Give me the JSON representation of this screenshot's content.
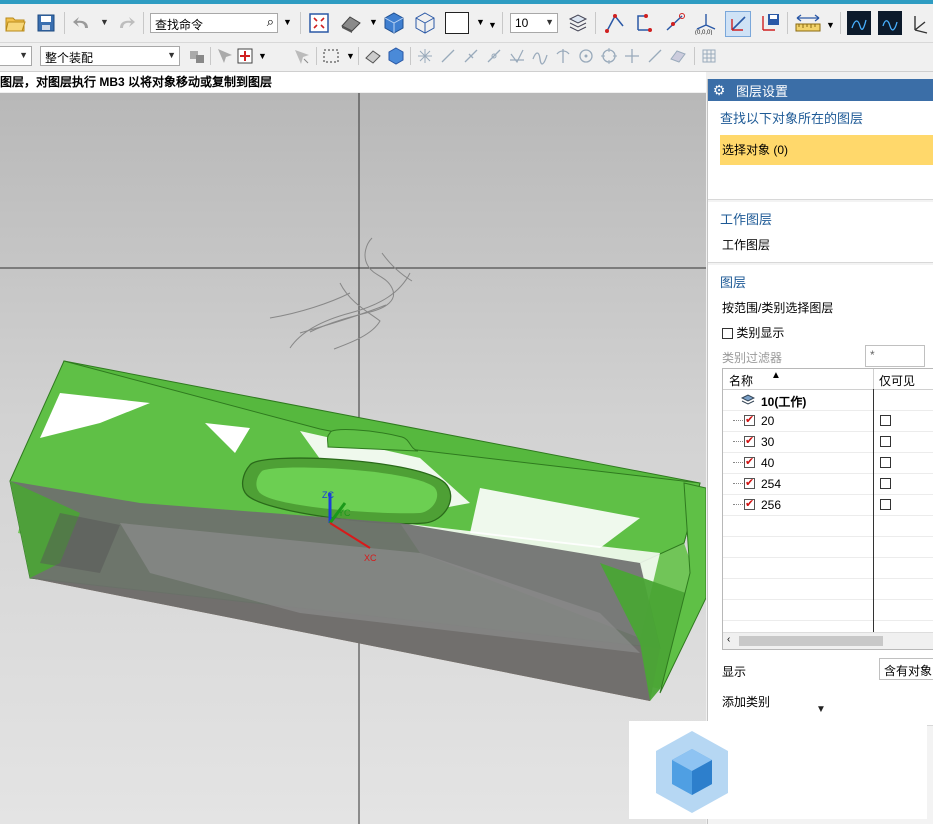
{
  "toolbar": {
    "command_search_placeholder": "查找命令",
    "layer_number": "10",
    "assembly_filter": "整个装配",
    "dropdown_arrow": "▼"
  },
  "status_hint": "图层，对图层执行 MB3 以将对象移动或复制到图层",
  "viewport": {
    "axis_labels": {
      "z": "ZC",
      "y": "YC",
      "x": "XC"
    },
    "model_color": "#5fc046",
    "base_color": "#8a7058"
  },
  "layer_panel": {
    "title": "图层设置",
    "find_section": {
      "title": "查找以下对象所在的图层",
      "select_objects": "选择对象 (0)"
    },
    "work_section": {
      "title": "工作图层",
      "label": "工作图层"
    },
    "layers_section": {
      "title": "图层",
      "select_by_range": "按范围/类别选择图层",
      "category_display": "类别显示",
      "category_filter_label": "类别过滤器",
      "category_filter_value": "*",
      "columns": [
        "名称",
        "仅可见"
      ],
      "rows": [
        {
          "name": "10(工作)",
          "work": true,
          "checked": true,
          "visible_only": false
        },
        {
          "name": "20",
          "work": false,
          "checked": true,
          "visible_only": false
        },
        {
          "name": "30",
          "work": false,
          "checked": true,
          "visible_only": false
        },
        {
          "name": "40",
          "work": false,
          "checked": true,
          "visible_only": false
        },
        {
          "name": "254",
          "work": false,
          "checked": true,
          "visible_only": false
        },
        {
          "name": "256",
          "work": false,
          "checked": true,
          "visible_only": false
        }
      ],
      "display_label": "显示",
      "display_value": "含有对象的",
      "add_category": "添加类别"
    }
  },
  "colors": {
    "header_blue": "#3b6ea7",
    "section_title": "#1e5a96",
    "highlight_yellow": "#ffd86b",
    "accent_cyan": "#2e9cc2"
  }
}
